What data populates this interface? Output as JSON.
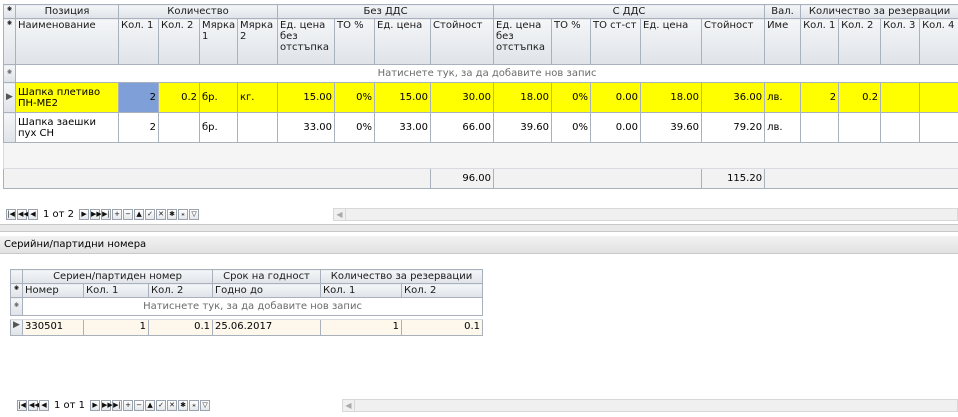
{
  "top_grid": {
    "bands": {
      "position": "Позиция",
      "quantity": "Количество",
      "without_vat": "Без ДДС",
      "with_vat": "С ДДС",
      "currency": "Вал.",
      "reserve_qty": "Количество за резервации"
    },
    "columns": {
      "name": "Наименование",
      "qty1": "Кол. 1",
      "qty2": "Кол. 2",
      "unit1": "Мярка 1",
      "unit2": "Мярка 2",
      "nv_price_nodisc": "Ед. цена без отстъпка",
      "nv_to_pct": "ТО %",
      "nv_price": "Ед. цена",
      "nv_value": "Стойност",
      "v_price_nodisc": "Ед. цена без отстъпка",
      "v_to_pct": "ТО %",
      "v_to_value": "ТО ст-ст",
      "v_price": "Ед. цена",
      "v_value": "Стойност",
      "cur_name": "Име",
      "r_qty1": "Кол. 1",
      "r_qty2": "Кол. 2",
      "r_qty3": "Кол. 3",
      "r_qty4": "Кол. 4"
    },
    "new_record_hint": "Натиснете тук, за да добавите нов запис",
    "rows": [
      {
        "name": "Шапка плетиво ПН-МЕ2",
        "qty1": "2",
        "qty2": "0.2",
        "unit1": "бр.",
        "unit2": "кг.",
        "nv_price_nodisc": "15.00",
        "nv_to_pct": "0%",
        "nv_price": "15.00",
        "nv_value": "30.00",
        "v_price_nodisc": "18.00",
        "v_to_pct": "0%",
        "v_to_value": "0.00",
        "v_price": "18.00",
        "v_value": "36.00",
        "cur_name": "лв.",
        "r_qty1": "2",
        "r_qty2": "0.2",
        "r_qty3": "",
        "r_qty4": ""
      },
      {
        "name": "Шапка заешки пух СН",
        "qty1": "2",
        "qty2": "",
        "unit1": "бр.",
        "unit2": "",
        "nv_price_nodisc": "33.00",
        "nv_to_pct": "0%",
        "nv_price": "33.00",
        "nv_value": "66.00",
        "v_price_nodisc": "39.60",
        "v_to_pct": "0%",
        "v_to_value": "0.00",
        "v_price": "39.60",
        "v_value": "79.20",
        "cur_name": "лв.",
        "r_qty1": "",
        "r_qty2": "",
        "r_qty3": "",
        "r_qty4": ""
      }
    ],
    "totals": {
      "nv_value": "96.00",
      "v_value": "115.20"
    },
    "nav": {
      "record": "1 от 2"
    }
  },
  "bottom_panel": {
    "title": "Серийни/партидни номера",
    "bands": {
      "serial": "Сериен/партиден номер",
      "expiry": "Срок на годност",
      "reserve_qty": "Количество за резервации"
    },
    "columns": {
      "number": "Номер",
      "qty1": "Кол. 1",
      "qty2": "Кол. 2",
      "valid_until": "Годно до",
      "r_qty1": "Кол. 1",
      "r_qty2": "Кол. 2"
    },
    "new_record_hint": "Натиснете тук, за да добавите нов запис",
    "rows": [
      {
        "number": "330501",
        "qty1": "1",
        "qty2": "0.1",
        "valid_until": "25.06.2017",
        "r_qty1": "1",
        "r_qty2": "0.1"
      }
    ],
    "nav": {
      "record": "1 от 1"
    }
  },
  "nav_icons": [
    "first-icon",
    "prev-page-icon",
    "prev-icon",
    "next-icon",
    "next-page-icon",
    "last-icon",
    "insert-icon",
    "delete-icon",
    "edit-icon",
    "post-icon",
    "cancel-icon",
    "refresh-icon",
    "filter-clear-icon",
    "filter-icon"
  ]
}
